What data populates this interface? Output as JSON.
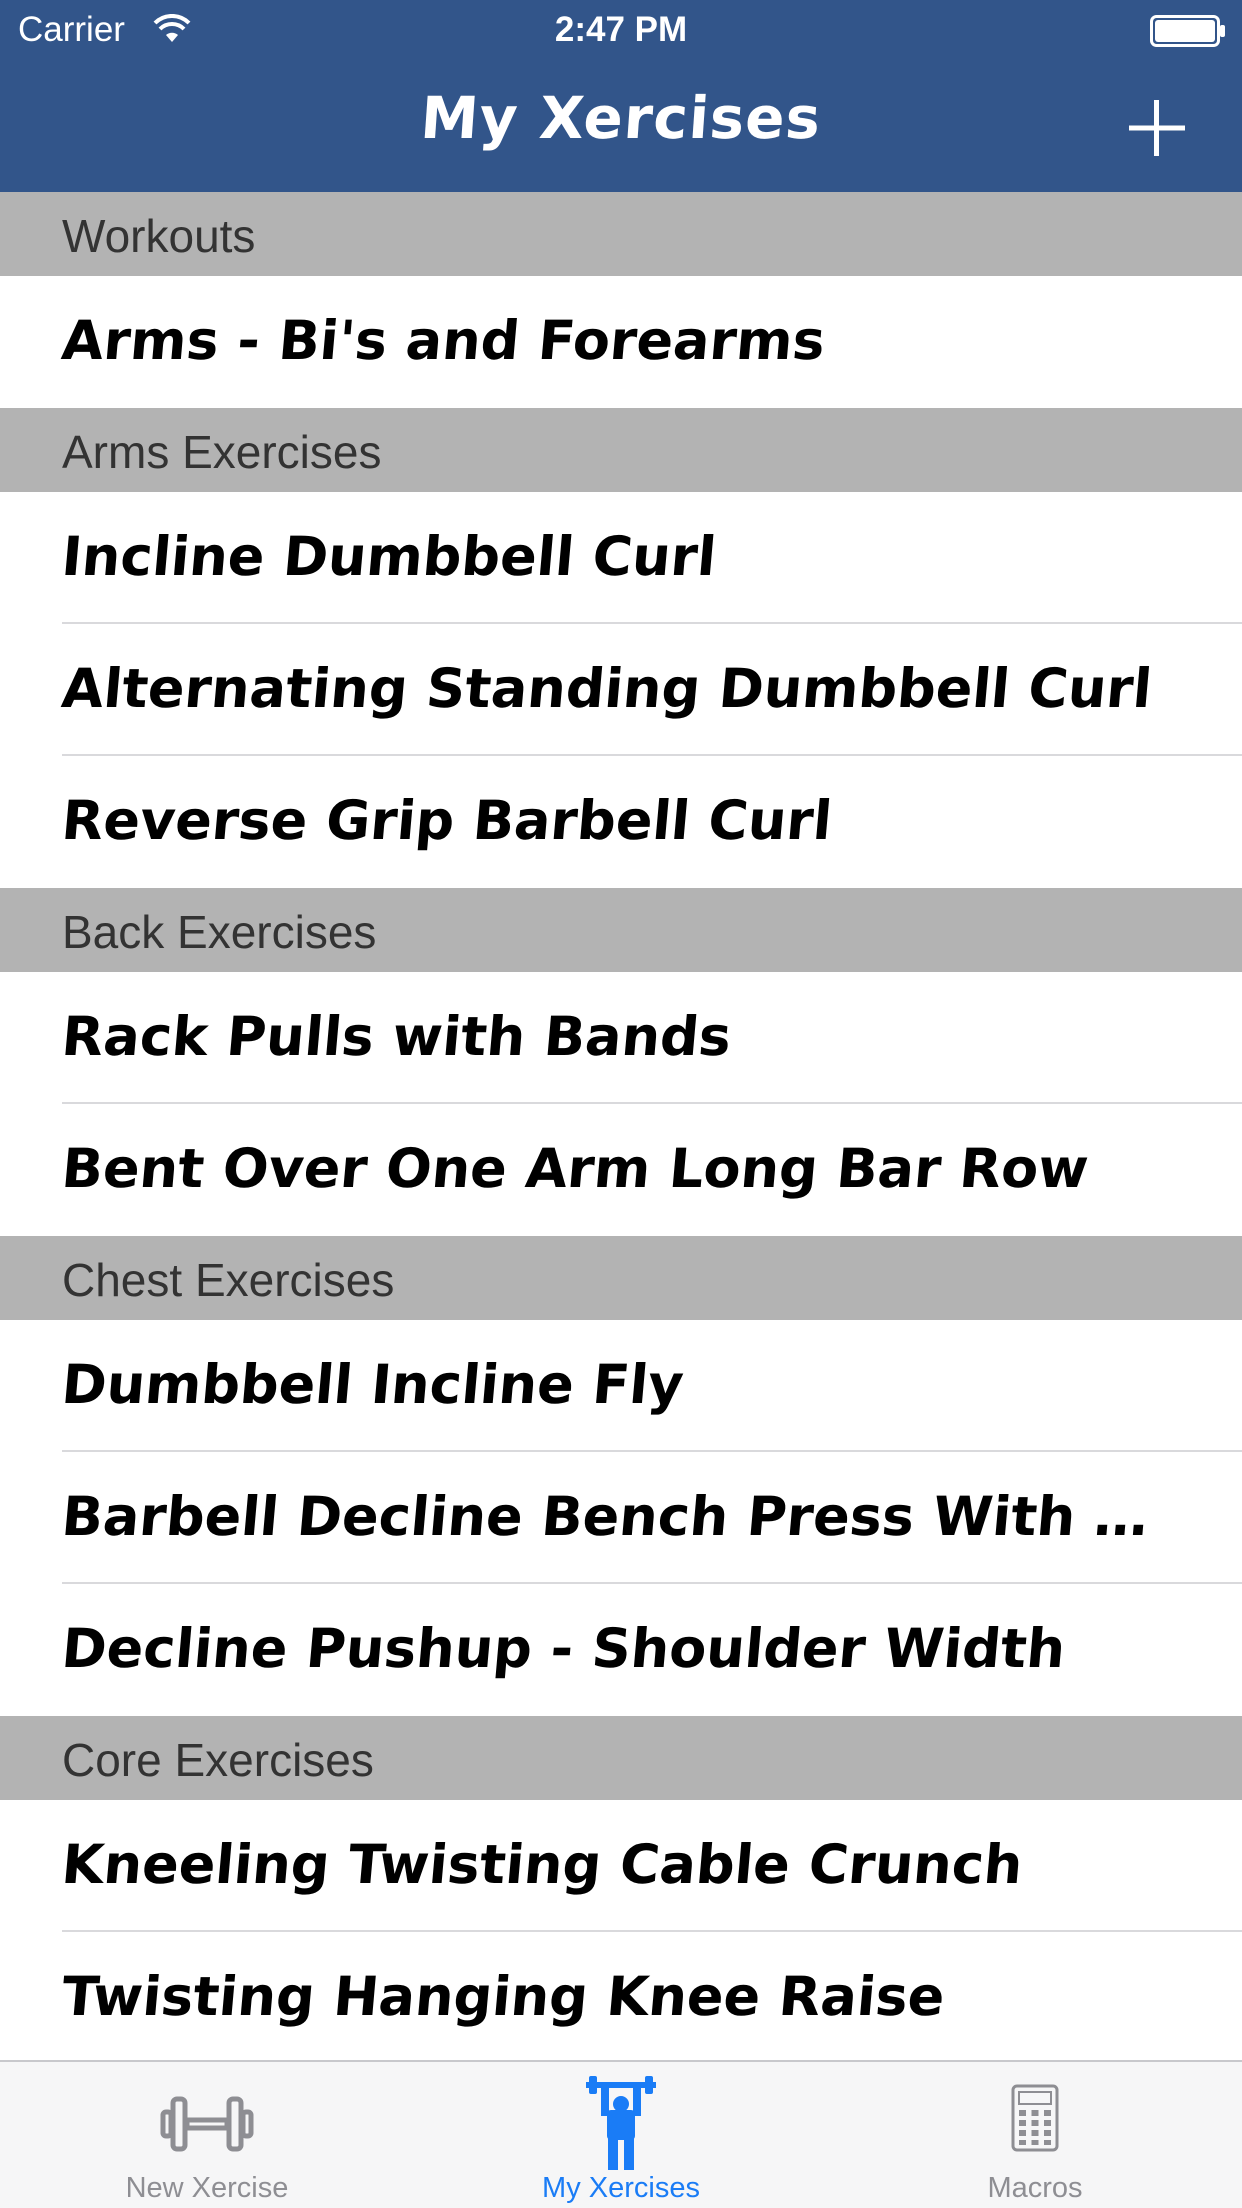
{
  "status_bar": {
    "carrier": "Carrier",
    "time": "2:47 PM"
  },
  "nav": {
    "title": "My Xercises",
    "add_icon": "plus-icon"
  },
  "sections": [
    {
      "title": "Workouts",
      "items": [
        "Arms - Bi's and Forearms"
      ]
    },
    {
      "title": "Arms Exercises",
      "items": [
        "Incline Dumbbell Curl",
        "Alternating Standing Dumbbell Curl",
        "Reverse Grip Barbell Curl"
      ]
    },
    {
      "title": "Back Exercises",
      "items": [
        "Rack Pulls with Bands",
        "Bent Over One Arm Long Bar Row"
      ]
    },
    {
      "title": "Chest Exercises",
      "items": [
        "Dumbbell Incline Fly",
        "Barbell Decline Bench Press With Bands - M...",
        "Decline Pushup - Shoulder Width"
      ]
    },
    {
      "title": "Core Exercises",
      "items": [
        "Kneeling Twisting Cable Crunch",
        "Twisting Hanging Knee Raise"
      ]
    }
  ],
  "tabs": [
    {
      "label": "New Xercise",
      "icon": "dumbbell-icon",
      "selected": false
    },
    {
      "label": "My Xercises",
      "icon": "weightlifter-icon",
      "selected": true
    },
    {
      "label": "Macros",
      "icon": "calculator-icon",
      "selected": false
    }
  ],
  "colors": {
    "nav_background": "#32558a",
    "section_background": "#b3b3b3",
    "tab_active": "#1a7cf6",
    "tab_inactive": "#8e8e93"
  }
}
